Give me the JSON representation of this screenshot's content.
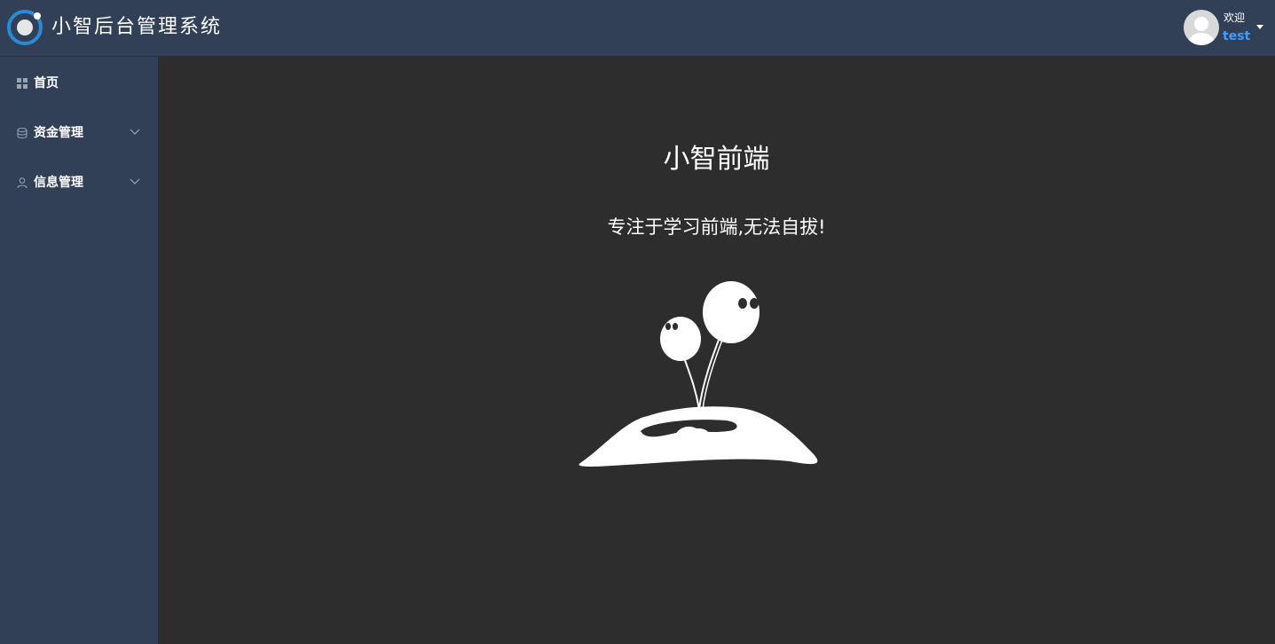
{
  "header": {
    "title": "小智后台管理系统",
    "logo_icon": "ring-logo-icon",
    "user": {
      "welcome": "欢迎",
      "name": "test",
      "name_color": "#409eff",
      "avatar_icon": "user-avatar-icon",
      "dropdown_icon": "caret-down-icon"
    }
  },
  "sidebar": {
    "items": [
      {
        "label": "首页",
        "icon": "grid-icon",
        "has_submenu": false
      },
      {
        "label": "资金管理",
        "icon": "database-icon",
        "has_submenu": true
      },
      {
        "label": "信息管理",
        "icon": "user-icon",
        "has_submenu": true
      }
    ]
  },
  "main": {
    "title": "小智前端",
    "subtitle": "专注于学习前端,无法自拔!",
    "illustration_icon": "sprout-island-illustration"
  },
  "colors": {
    "header_bg": "#324057",
    "sidebar_bg": "#324057",
    "main_bg": "#2d2d2d",
    "accent": "#409eff"
  }
}
